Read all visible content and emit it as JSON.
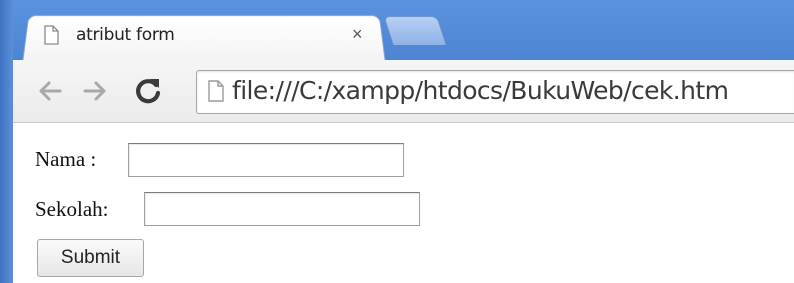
{
  "window": {
    "tab": {
      "title": "atribut form",
      "close_glyph": "×",
      "favicon": "page-icon"
    }
  },
  "toolbar": {
    "back_icon": "back-arrow-icon",
    "forward_icon": "forward-arrow-icon",
    "reload_icon": "reload-icon",
    "address": "file:///C:/xampp/htdocs/BukuWeb/cek.htm"
  },
  "form": {
    "nama_label": "Nama :",
    "nama_value": "",
    "sekolah_label": "Sekolah:",
    "sekolah_value": "",
    "submit_label": "Submit"
  },
  "colors": {
    "frame_blue": "#4d84d3",
    "toolbar_gray": "#ebebeb",
    "disabled_arrow": "#a8a8a8",
    "reload_dark": "#3a3a3a"
  }
}
